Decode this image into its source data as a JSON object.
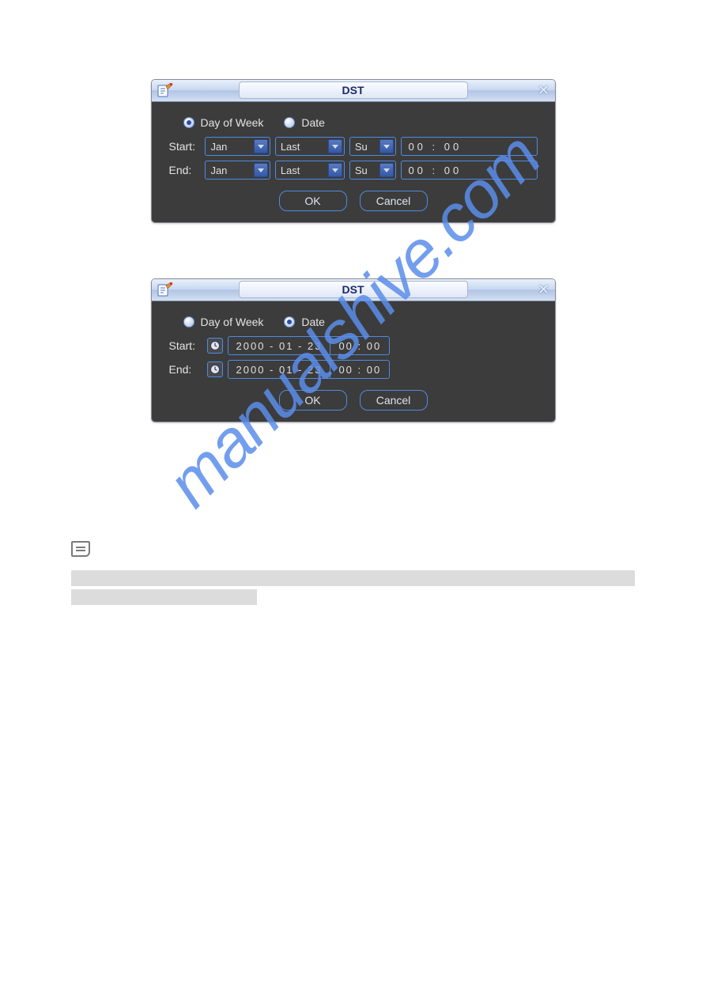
{
  "dialog1": {
    "title": "DST",
    "radios": {
      "day_of_week_label": "Day of Week",
      "date_label": "Date",
      "selected": "day_of_week"
    },
    "rows": {
      "start_label": "Start:",
      "end_label": "End:"
    },
    "values": {
      "start": {
        "month": "Jan",
        "week": "Last",
        "day": "Su",
        "time": "00   :   00"
      },
      "end": {
        "month": "Jan",
        "week": "Last",
        "day": "Su",
        "time": "00   :   00"
      }
    },
    "buttons": {
      "ok": "OK",
      "cancel": "Cancel"
    }
  },
  "dialog2": {
    "title": "DST",
    "radios": {
      "day_of_week_label": "Day of Week",
      "date_label": "Date",
      "selected": "date"
    },
    "rows": {
      "start_label": "Start:",
      "end_label": "End:"
    },
    "values": {
      "start": {
        "date": "2000  -  01 -  23",
        "time": "00 : 00"
      },
      "end": {
        "date": "2000  -  01 -  23",
        "time": "00 : 00"
      }
    },
    "buttons": {
      "ok": "OK",
      "cancel": "Cancel"
    }
  },
  "watermark": "manualshive.com"
}
